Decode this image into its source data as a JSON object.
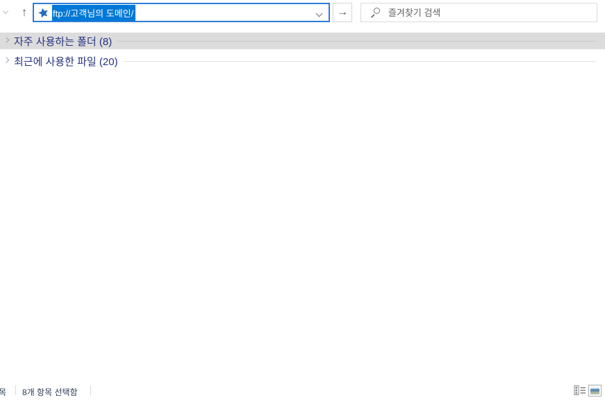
{
  "window": {
    "kind": "file-explorer-quick-access"
  },
  "toolbar": {
    "up_icon": "↑",
    "go_icon": "→",
    "address": {
      "value": "ftp://고객님의 도메인/",
      "selected": true,
      "pinned_icon": "quick-access-star"
    },
    "search_placeholder": "즐겨찾기 검색"
  },
  "groups": [
    {
      "label": "자주 사용하는 폴더 (8)",
      "count": 8,
      "collapsed": true,
      "highlighted": true
    },
    {
      "label": "최근에 사용한 파일 (20)",
      "count": 20,
      "collapsed": true,
      "highlighted": false
    }
  ],
  "statusbar": {
    "left_partial_text": "목",
    "selection_text": "8개 항목 선택함",
    "view_buttons": [
      "details-view",
      "large-thumbnails-view"
    ]
  },
  "colors": {
    "accent": "#0078d7",
    "address_border_focused": "#2b7dd8",
    "selection_bg": "#0078d7",
    "selection_text": "#ffffff",
    "group_header_text": "#24317e",
    "group_band_bg": "#dcdcdc",
    "search_border": "#d9d9d9",
    "status_text": "#2b3a55"
  }
}
